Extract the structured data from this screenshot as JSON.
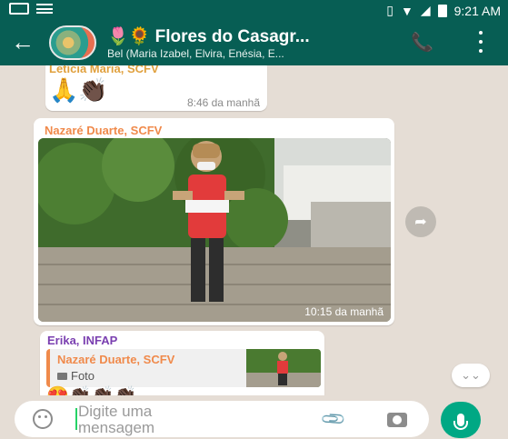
{
  "status_bar": {
    "time": "9:21 AM",
    "network": "4G"
  },
  "header": {
    "title": "🌷🌻 Flores do Casagr...",
    "subtitle": "Bel (Maria Izabel, Elvira, Enésia, E...",
    "icons": [
      "arrow-back-icon",
      "group-avatar",
      "add-call-icon",
      "more-vert-icon"
    ]
  },
  "messages": [
    {
      "sender": "Letícia Maria, SCFV",
      "sender_color": "#e0a03d",
      "content": "🙏👏🏿",
      "time": "8:46 da manhã"
    },
    {
      "sender": "Nazaré Duarte, SCFV",
      "sender_color": "#f08a4b",
      "type": "photo",
      "time": "10:15 da manhã"
    },
    {
      "sender": "Erika, INFAP",
      "sender_color": "#7a3fb0",
      "quote": {
        "sender": "Nazaré Duarte, SCFV",
        "label": "Foto"
      },
      "content": "😍👏🏿👏🏿👏🏿"
    }
  ],
  "composer": {
    "placeholder": "Digite uma mensagem",
    "accent": "#00a884"
  },
  "theme": {
    "primary": "#075e54",
    "background": "#e5ddd5"
  }
}
